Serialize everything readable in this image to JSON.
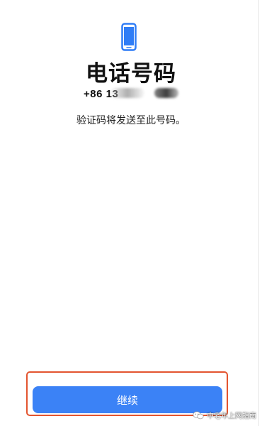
{
  "header": {
    "icon": "phone-icon",
    "title": "电话号码",
    "phone_number": "+86 13",
    "phone_number_redacted": true,
    "subtitle": "验证码将发送至此号码。"
  },
  "footer": {
    "continue_label": "继续"
  },
  "watermark": {
    "icon": "wechat-icon",
    "text": "中老年上网指南"
  },
  "colors": {
    "accent": "#3b82f6",
    "highlight": "#e3542f",
    "text": "#111111"
  }
}
